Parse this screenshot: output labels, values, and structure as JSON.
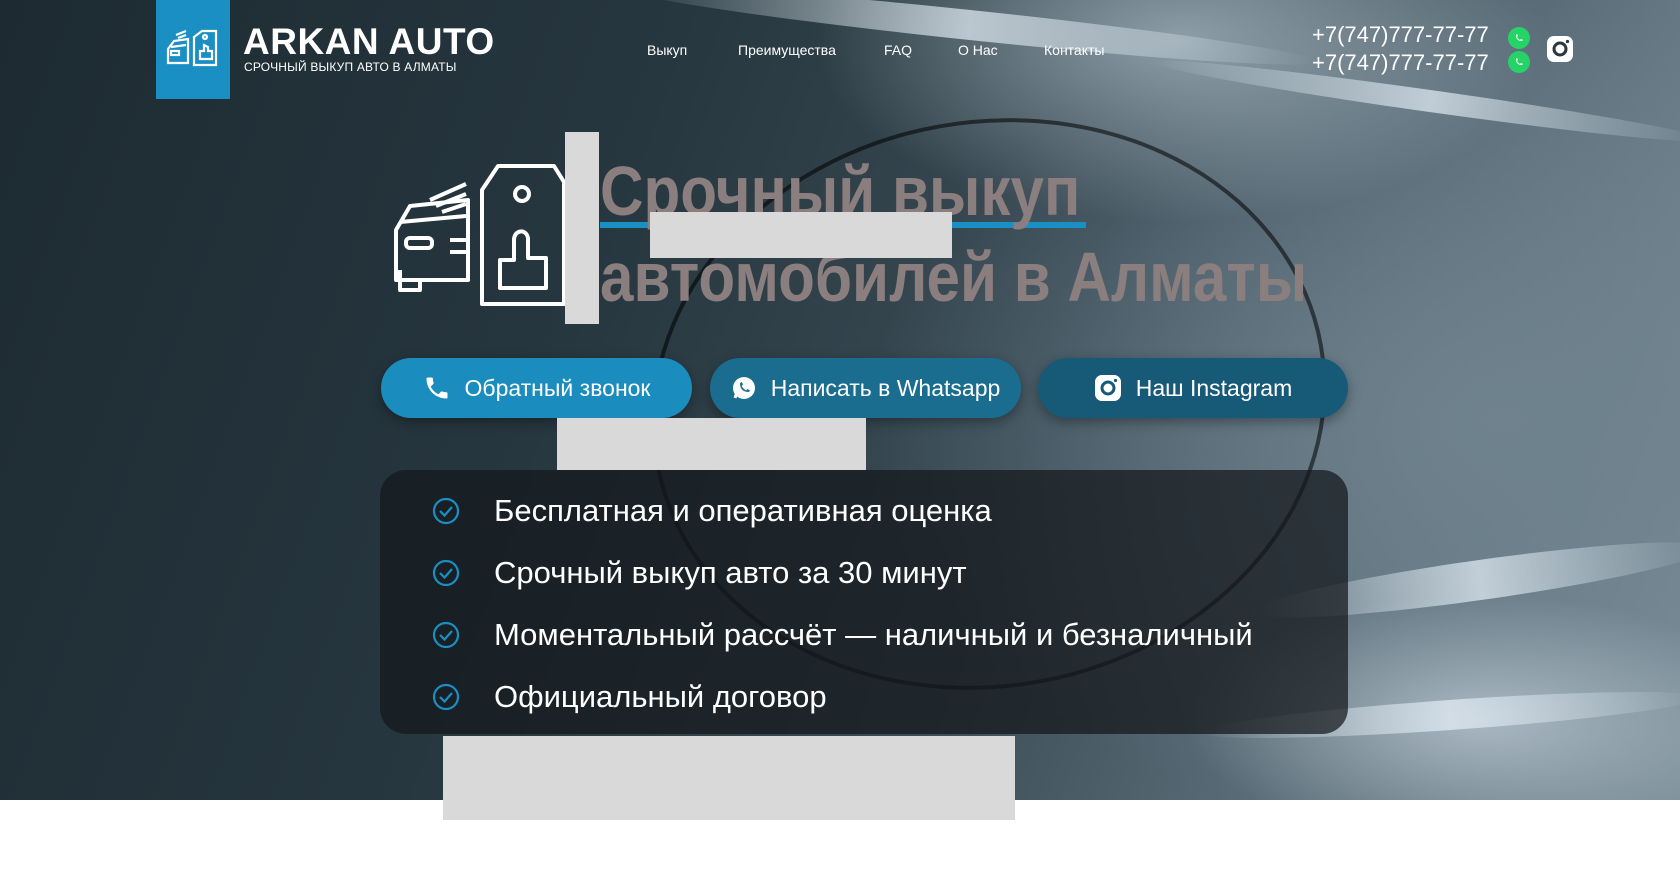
{
  "brand": {
    "title": "ARKAN AUTO",
    "subtitle": "СРОЧНЫЙ ВЫКУП АВТО В АЛМАТЫ"
  },
  "nav": {
    "items": [
      {
        "label": "Выкуп"
      },
      {
        "label": "Преимущества"
      },
      {
        "label": "FAQ"
      },
      {
        "label": "О Нас"
      },
      {
        "label": "Контакты"
      }
    ]
  },
  "contacts": {
    "phones": [
      "+7(747)777-77-77",
      "+7(747)777-77-77"
    ]
  },
  "hero": {
    "headline_line1": "Срочный выкуп",
    "headline_line2": "автомобилей в Алматы"
  },
  "buttons": {
    "callback": "Обратный звонок",
    "whatsapp": "Написать в Whatsapp",
    "instagram": "Наш Instagram"
  },
  "features": [
    "Бесплатная и оперативная оценка",
    "Срочный выкуп авто за 30 минут",
    "Моментальный рассчёт — наличный и безналичный",
    "Официальный договор"
  ],
  "colors": {
    "accent": "#1a8fc4",
    "whatsapp": "#25d366",
    "headline": "#8a7e7e"
  }
}
